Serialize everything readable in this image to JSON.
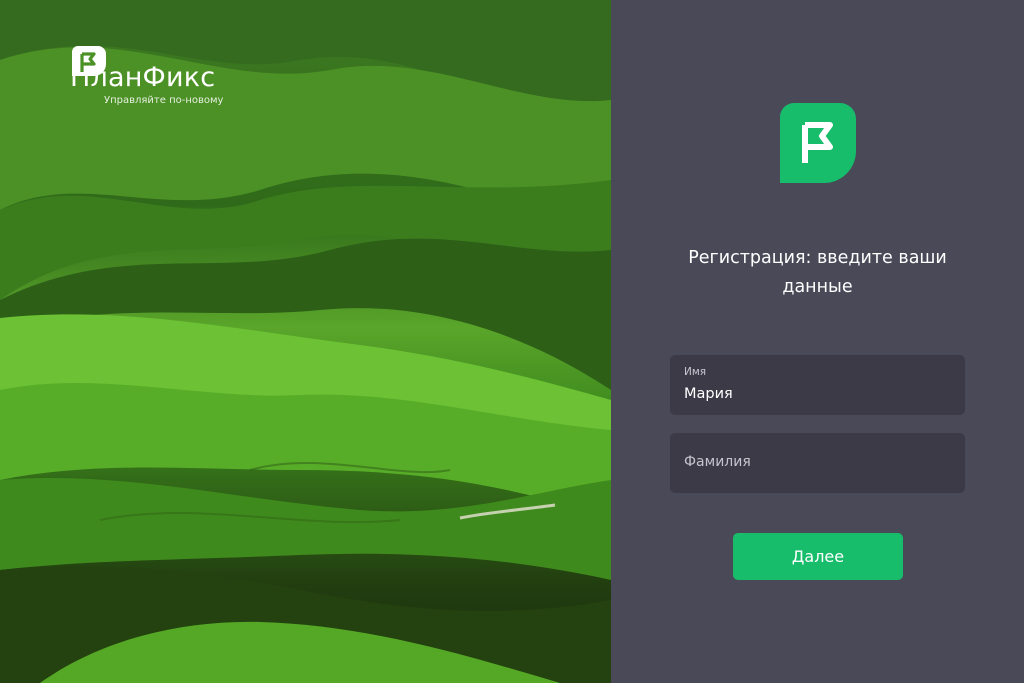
{
  "brand": {
    "name": "ПланФикс",
    "tagline": "Управляйте по-новому",
    "logo_icon": "flag-icon"
  },
  "registration": {
    "heading": "Регистрация: введите ваши данные",
    "first_name": {
      "label": "Имя",
      "value": "Мария"
    },
    "last_name": {
      "placeholder": "Фамилия",
      "value": ""
    },
    "next_button": "Далее"
  },
  "colors": {
    "accent": "#17bd6b",
    "panel_background": "#4a4958",
    "field_background": "#3b3a46"
  }
}
